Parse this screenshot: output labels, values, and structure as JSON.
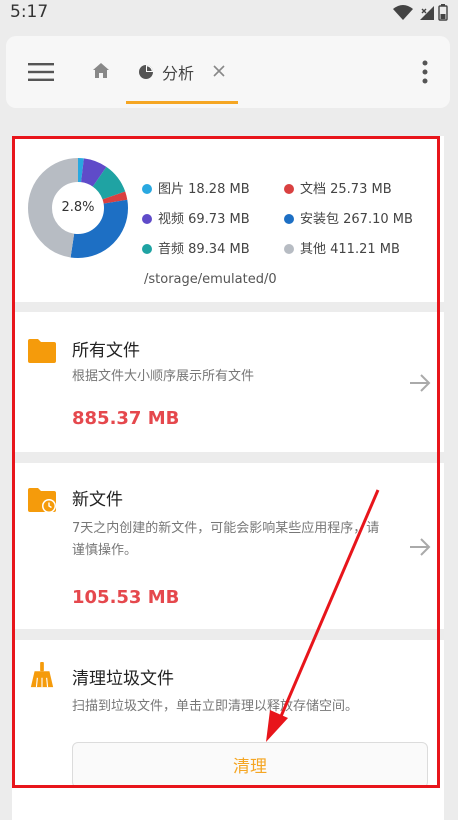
{
  "status_bar": {
    "time": "5:17"
  },
  "toolbar": {
    "tab_label": "分析"
  },
  "storage": {
    "percent": "2.8%",
    "used_fraction": 0.028,
    "path": "/storage/emulated/0",
    "legend": [
      {
        "label": "图片 18.28 MB",
        "color": "#29a8e0",
        "share": 0.019
      },
      {
        "label": "文档 25.73 MB",
        "color": "#d94040",
        "share": 0.027
      },
      {
        "label": "视频 69.73 MB",
        "color": "#5f4bc9",
        "share": 0.077
      },
      {
        "label": "安装包 267.10 MB",
        "color": "#1d6fc4",
        "share": 0.3
      },
      {
        "label": "音频 89.34 MB",
        "color": "#1fa3a3",
        "share": 0.1
      },
      {
        "label": "其他 411.21 MB",
        "color": "#b7bcc3",
        "share": 0.477
      }
    ]
  },
  "all_files": {
    "title": "所有文件",
    "desc": "根据文件大小顺序展示所有文件",
    "size": "885.37 MB"
  },
  "new_files": {
    "title": "新文件",
    "desc": "7天之内创建的新文件，可能会影响某些应用程序，请谨慎操作。",
    "size": "105.53 MB"
  },
  "junk": {
    "title": "清理垃圾文件",
    "desc": "扫描到垃圾文件，单击立即清理以释放存储空间。",
    "button_label": "清理"
  },
  "colors": {
    "accent": "#f5a623",
    "size_text": "#e5484d",
    "annotation": "#e8151b"
  }
}
